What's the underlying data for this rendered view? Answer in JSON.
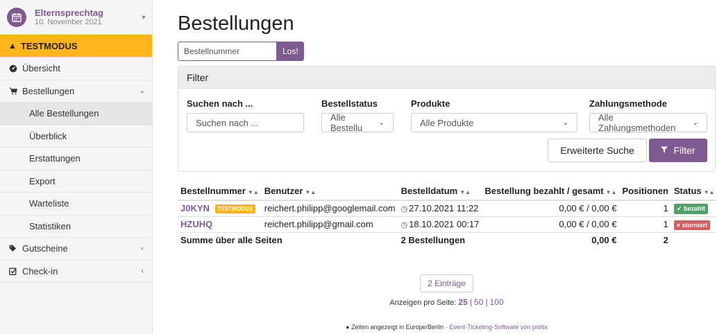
{
  "sidebar": {
    "event_name": "Elternsprechtag",
    "event_date": "10. November 2021",
    "testmode": "TESTMODUS",
    "items": [
      {
        "label": "Übersicht"
      },
      {
        "label": "Bestellungen"
      },
      {
        "label": "Gutscheine"
      },
      {
        "label": "Check-in"
      }
    ],
    "sub_items": [
      {
        "label": "Alle Bestellungen"
      },
      {
        "label": "Überblick"
      },
      {
        "label": "Erstattungen"
      },
      {
        "label": "Export"
      },
      {
        "label": "Warteliste"
      },
      {
        "label": "Statistiken"
      }
    ]
  },
  "page": {
    "title": "Bestellungen",
    "quick_search_placeholder": "Bestellnummer",
    "quick_search_button": "Los!"
  },
  "filter": {
    "heading": "Filter",
    "search_label": "Suchen nach ...",
    "search_placeholder": "Suchen nach ...",
    "status_label": "Bestellstatus",
    "status_value": "Alle Bestellu",
    "products_label": "Produkte",
    "products_value": "Alle Produkte",
    "payment_label": "Zahlungsmethode",
    "payment_value": "Alle Zahlungsmethoden",
    "advanced_button": "Erweiterte Suche",
    "filter_button": "Filter"
  },
  "table": {
    "headers": {
      "code": "Bestellnummer",
      "user": "Benutzer",
      "date": "Bestelldatum",
      "paid": "Bestellung bezahlt / gesamt",
      "positions": "Positionen",
      "status": "Status"
    },
    "rows": [
      {
        "code": "J0KYN",
        "tag": "TESTMODUS",
        "user": "reichert.philipp@googlemail.com",
        "date": "27.10.2021 11:22",
        "amount": "0,00 € / 0,00 €",
        "positions": "1",
        "status": "bezahlt"
      },
      {
        "code": "HZUHQ",
        "tag": "",
        "user": "reichert.philipp@gmail.com",
        "date": "18.10.2021 00:17",
        "amount": "0,00 € / 0,00 €",
        "positions": "1",
        "status": "storniert"
      }
    ],
    "summary": {
      "label": "Summe über alle Seiten",
      "orders": "2 Bestellungen",
      "total": "0,00 €",
      "positions": "2"
    }
  },
  "pagination": {
    "count": "2 Einträge",
    "per_page_label": "Anzeigen pro Seite:",
    "options": [
      "25",
      "50",
      "100"
    ]
  },
  "footer": {
    "timezone": "Zeiten angezeigt in Europe/Berlin",
    "separator": " · ",
    "software": "Event-Ticketing-Software von pretix"
  },
  "colors": {
    "brand": "#7f5a91",
    "testmode": "#ffb419",
    "paid": "#50a167",
    "canceled": "#d36060"
  }
}
